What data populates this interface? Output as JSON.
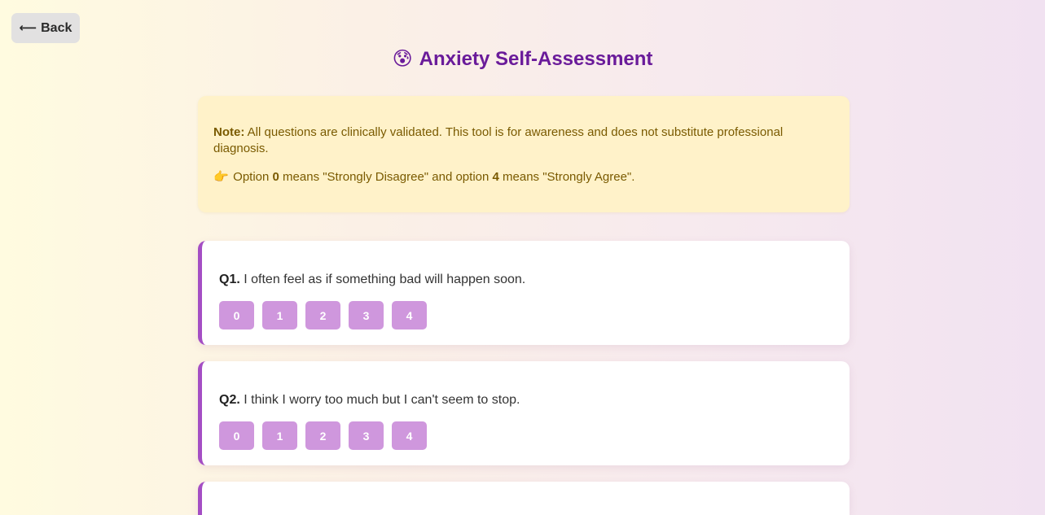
{
  "back_button": {
    "arrow": "⟵",
    "label": "Back"
  },
  "header": {
    "emoji": "😰",
    "title": "Anxiety Self-Assessment"
  },
  "note": {
    "label": "Note:",
    "text": " All questions are clinically validated. This tool is for awareness and does not substitute professional diagnosis.",
    "hand": "👉",
    "hint_pre": " Option ",
    "hint_min": "0",
    "hint_mid": " means \"Strongly Disagree\" and option ",
    "hint_max": "4",
    "hint_post": " means \"Strongly Agree\"."
  },
  "questions": [
    {
      "number": "Q1.",
      "text": " I often feel as if something bad will happen soon.",
      "options": [
        "0",
        "1",
        "2",
        "3",
        "4"
      ]
    },
    {
      "number": "Q2.",
      "text": " I think I worry too much but I can't seem to stop.",
      "options": [
        "0",
        "1",
        "2",
        "3",
        "4"
      ]
    },
    {
      "number": "",
      "text": "",
      "options": []
    }
  ],
  "colors": {
    "title": "#6a1b9a",
    "accent_border": "#a44ec4",
    "option_bg": "#cf97dd",
    "note_bg": "#fff2c9",
    "note_text": "#7a5a00"
  }
}
